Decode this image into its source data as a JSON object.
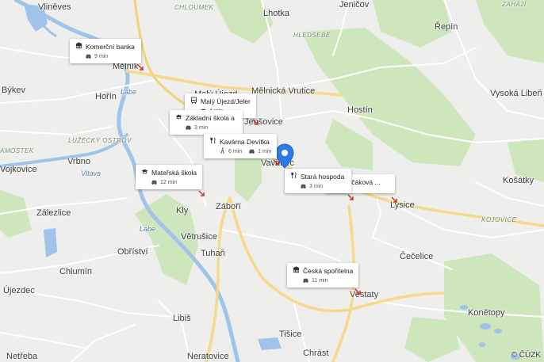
{
  "places": [
    {
      "name": "Vliněves"
    },
    {
      "name": "CHLOUMEK"
    },
    {
      "name": "Lhotka"
    },
    {
      "name": "Jeničov"
    },
    {
      "name": "ZAHÁJÍ"
    },
    {
      "name": "HLEDSEBE"
    },
    {
      "name": "Řepín"
    },
    {
      "name": "Mělník"
    },
    {
      "name": "Býkev"
    },
    {
      "name": "Hořín"
    },
    {
      "name": "Malý Újezd"
    },
    {
      "name": "Mělnická Vrutice"
    },
    {
      "name": "Hostín"
    },
    {
      "name": "Vysoká Libeň"
    },
    {
      "name": "Labe"
    },
    {
      "name": "LUŽECKÝ OSTROV"
    },
    {
      "name": "AMOSTEK"
    },
    {
      "name": "Vrbno"
    },
    {
      "name": "Jenšovice"
    },
    {
      "name": "Vavřinec"
    },
    {
      "name": "Vltava"
    },
    {
      "name": "Vojkovice"
    },
    {
      "name": "Košátky"
    },
    {
      "name": "Zálezlice"
    },
    {
      "name": "Kly"
    },
    {
      "name": "Záboří"
    },
    {
      "name": "Lysice"
    },
    {
      "name": "KOJOVICE"
    },
    {
      "name": "Větrušice"
    },
    {
      "name": "Obříství"
    },
    {
      "name": "Tuhaň"
    },
    {
      "name": "Čečelice"
    },
    {
      "name": "Chlumín"
    },
    {
      "name": "Újezdec"
    },
    {
      "name": "Vestaty"
    },
    {
      "name": "Konětopy"
    },
    {
      "name": "Libiš"
    },
    {
      "name": "Tišice"
    },
    {
      "name": "Netřeba"
    },
    {
      "name": "Neratovice"
    },
    {
      "name": "Chrást"
    },
    {
      "name": "Labe"
    }
  ],
  "cards": [
    {
      "title": "Komerční banka",
      "category_icon": "bank-icon",
      "durations": [
        {
          "mode": "car-icon",
          "text": "9 min"
        }
      ]
    },
    {
      "title": "Malý Újezd/Jelenice",
      "category_icon": "bus-icon",
      "durations": [
        {
          "mode": "car-icon",
          "text": "4 min"
        }
      ]
    },
    {
      "title": "Základní škola a ...",
      "category_icon": "school-icon",
      "durations": [
        {
          "mode": "car-icon",
          "text": "3 min"
        }
      ]
    },
    {
      "title": "Kavárna Devítka",
      "category_icon": "restaurant-icon",
      "durations": [
        {
          "mode": "walk-icon",
          "text": "6 min"
        },
        {
          "mode": "car-icon",
          "text": "1 min"
        }
      ]
    },
    {
      "title": "Mateřská škola",
      "category_icon": "school-icon",
      "durations": [
        {
          "mode": "car-icon",
          "text": "12 min"
        }
      ]
    },
    {
      "title": "Korčáková ...",
      "category_icon": "restaurant-icon",
      "durations": []
    },
    {
      "title": "Stará hospoda Li...",
      "category_icon": "restaurant-icon",
      "durations": [
        {
          "mode": "car-icon",
          "text": "3 min"
        }
      ]
    },
    {
      "title": "Česká spořitelna",
      "category_icon": "bank-icon",
      "durations": [
        {
          "mode": "car-icon",
          "text": "11 min"
        }
      ]
    }
  ],
  "attribution": "© ČÚZK",
  "colors": {
    "water": "#9fc3ea",
    "forest": "#cde6bc",
    "road": "#ffffff",
    "major_road": "#f7d98b",
    "marker": "#2f7be6"
  }
}
